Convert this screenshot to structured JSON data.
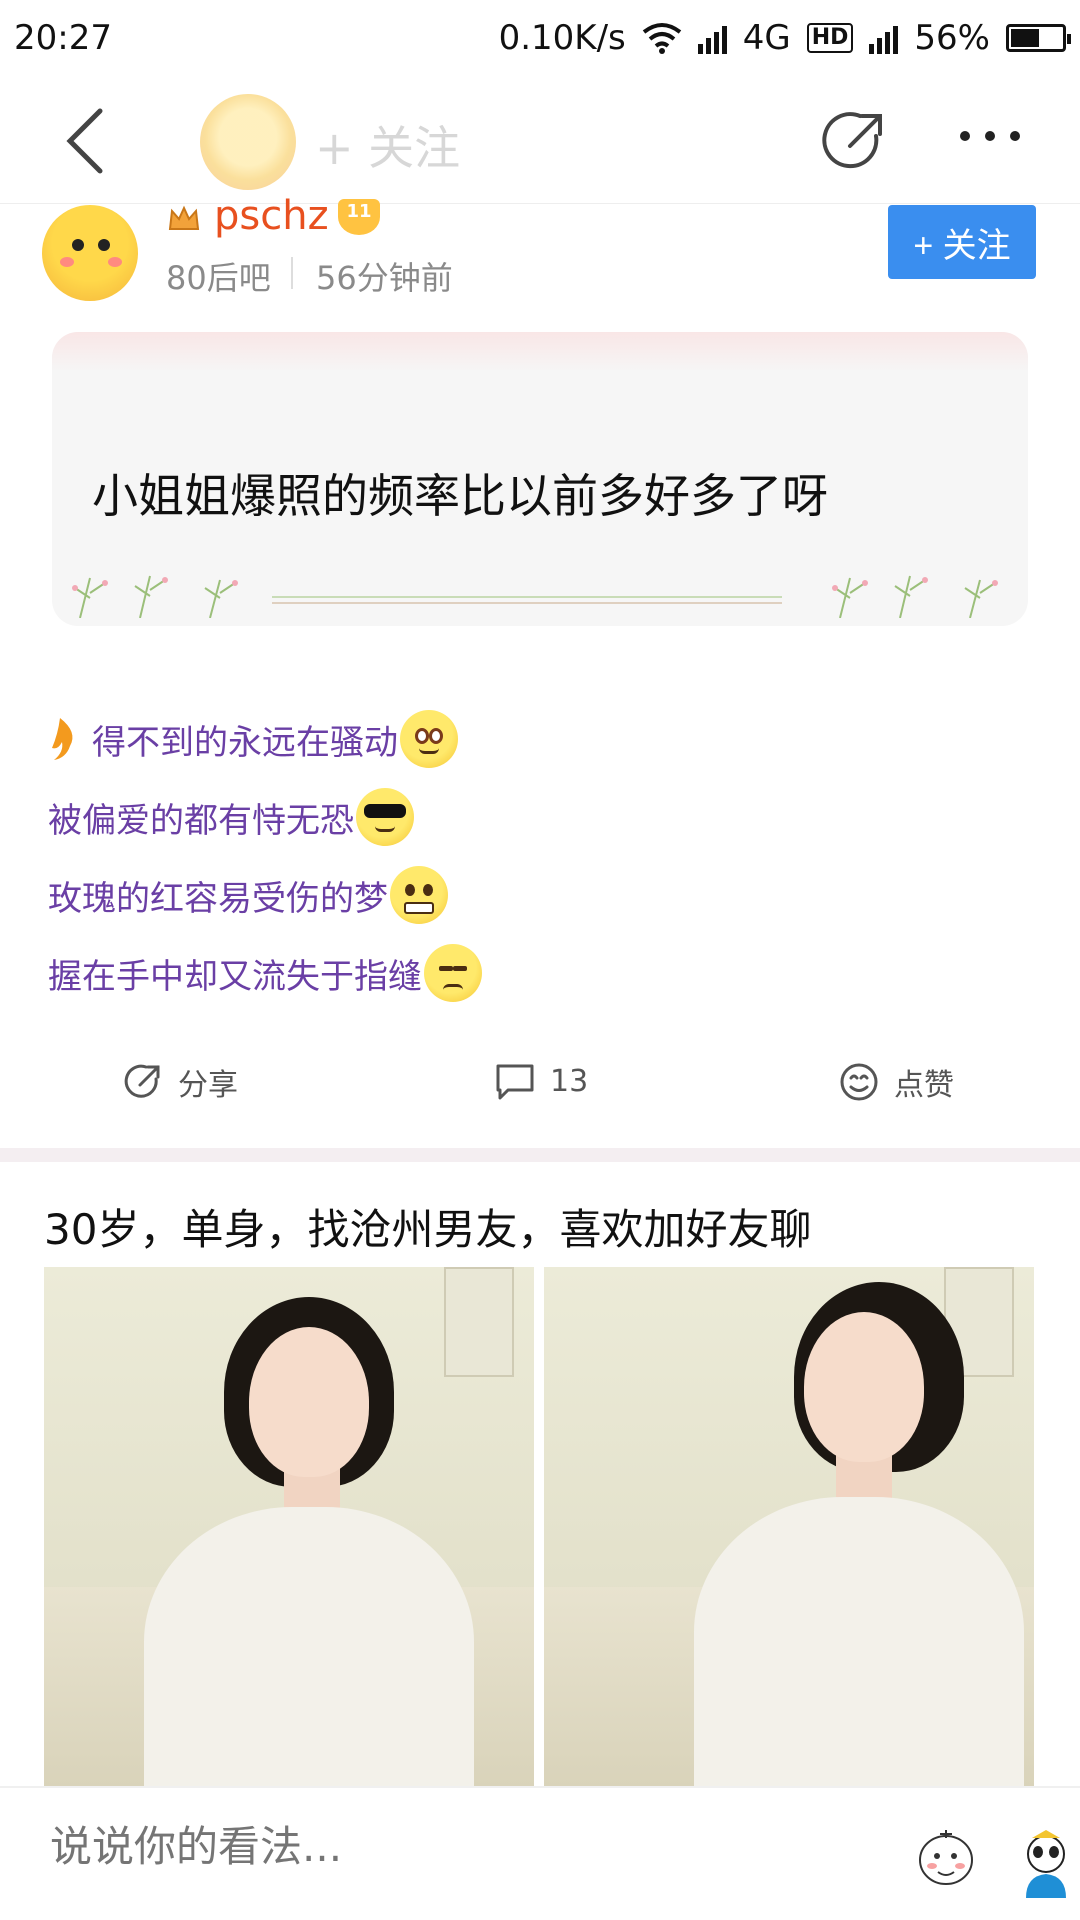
{
  "status": {
    "time": "20:27",
    "speed": "0.10K/s",
    "network": "4G",
    "hd": "HD",
    "battery_text": "56%",
    "battery_level": 0.56
  },
  "nav": {
    "follow_label": "+ 关注"
  },
  "post": {
    "username": "pschz",
    "level": "11",
    "forum": "80后吧",
    "time": "56分钟前",
    "follow_button": "+ 关注",
    "quote": "小姐姐爆照的频率比以前多好多了呀",
    "lines": [
      {
        "text": "得不到的永远在骚动",
        "emoji": "wide-eyes-emoji"
      },
      {
        "text": "被偏爱的都有恃无恐",
        "emoji": "sunglasses-emoji"
      },
      {
        "text": "玫瑰的红容易受伤的梦",
        "emoji": "grimace-emoji"
      },
      {
        "text": "握在手中却又流失于指缝",
        "emoji": "unamused-emoji"
      }
    ],
    "actions": {
      "share": "分享",
      "comments": "13",
      "like": "点赞"
    }
  },
  "post2": {
    "title": "30岁，单身，找沧州男友，喜欢加好友聊"
  },
  "comment_bar": {
    "placeholder": "说说你的看法..."
  },
  "colors": {
    "accent": "#3a8eef",
    "username": "#e8501f",
    "body_text": "#6a3fa5"
  }
}
